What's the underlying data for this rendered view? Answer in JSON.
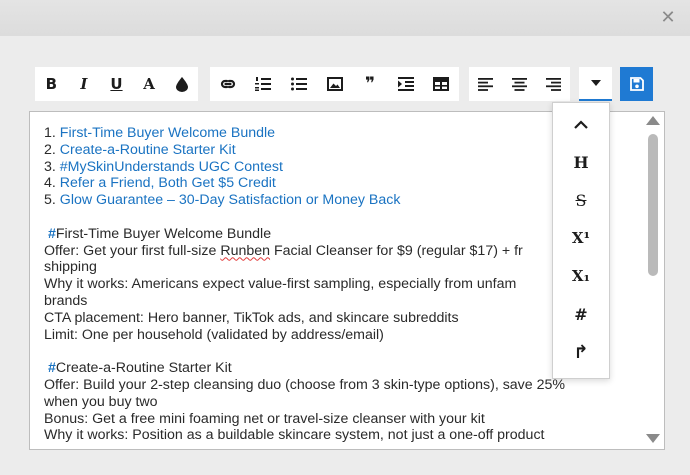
{
  "dialog": {
    "close_glyph": "✕"
  },
  "toolbar": {
    "bold": "B",
    "italic": "I",
    "underline": "U",
    "font_color": "A",
    "highlight_icon": "ink-drop-icon",
    "link_icon": "link-icon",
    "ordered_list_icon": "ordered-list-icon",
    "bullet_list_icon": "bullet-list-icon",
    "image_icon": "image-icon",
    "quote_glyph": "❞",
    "indent_icon": "indent-icon",
    "table_icon": "table-icon",
    "align_left_icon": "align-left-icon",
    "align_center_icon": "align-center-icon",
    "align_right_icon": "align-right-icon",
    "more_icon": "caret-down-icon",
    "save_icon": "floppy-disk-icon",
    "accent_color": "#1f7ad3"
  },
  "more_menu": {
    "items": [
      {
        "glyph": "⌃",
        "name": "collapse"
      },
      {
        "glyph": "H",
        "name": "heading"
      },
      {
        "glyph": "S",
        "name": "strikethrough"
      },
      {
        "glyph": "X¹",
        "name": "superscript"
      },
      {
        "glyph": "X₁",
        "name": "subscript"
      },
      {
        "glyph": "#",
        "name": "hashtag"
      },
      {
        "glyph": "↱",
        "name": "redo"
      }
    ]
  },
  "editor": {
    "list": [
      {
        "num": "1.",
        "text": "First-Time Buyer Welcome Bundle"
      },
      {
        "num": "2.",
        "text": "Create-a-Routine Starter Kit"
      },
      {
        "num": "3.",
        "text": "#MySkinUnderstands UGC Contest"
      },
      {
        "num": "4.",
        "text": "Refer a Friend, Both Get $5 Credit"
      },
      {
        "num": "5.",
        "text": "Glow Guarantee – 30-Day Satisfaction or Money Back"
      }
    ],
    "section1": {
      "hash": "#",
      "title": "First-Time Buyer Welcome Bundle",
      "offer_pre": "Offer: Get your first full-size ",
      "offer_brand": "Runben",
      "offer_post": " Facial Cleanser for $9 (regular $17) + fr",
      "offer_cont": "shipping",
      "why": "Why it works: Americans expect value-first sampling, especially from unfam",
      "why_cont": "brands",
      "cta": "CTA placement: Hero banner, TikTok ads, and skincare subreddits",
      "limit": "Limit: One per household (validated by address/email)"
    },
    "section2": {
      "hash": "#",
      "title": "Create-a-Routine Starter Kit",
      "offer": "Offer: Build your 2-step cleansing duo (choose from 3 skin-type options), save 25%",
      "offer_cont": "when you buy two",
      "bonus": "Bonus: Get a free mini foaming net or travel-size cleanser with your kit",
      "why": "Why it works: Position as a buildable skincare system, not just a one-off product"
    },
    "link_color": "#1a73c2"
  }
}
